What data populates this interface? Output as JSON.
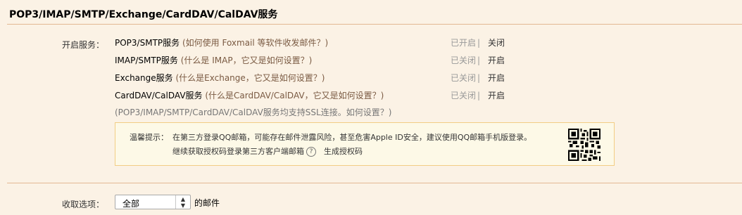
{
  "header": {
    "title": "POP3/IMAP/SMTP/Exchange/CardDAV/CalDAV服务"
  },
  "services_section": {
    "label": "开启服务：",
    "services": [
      {
        "name": "POP3/SMTP服务",
        "help": "(如何使用 Foxmail 等软件收发邮件？)",
        "status": "已开启",
        "action": "关闭"
      },
      {
        "name": "IMAP/SMTP服务",
        "help": "(什么是 IMAP，它又是如何设置？)",
        "status": "已关闭",
        "action": "开启"
      },
      {
        "name": "Exchange服务",
        "help": "(什么是Exchange，它又是如何设置？)",
        "status": "已关闭",
        "action": "开启"
      },
      {
        "name": "CardDAV/CalDAV服务",
        "help": "(什么是CardDAV/CalDAV，它又是如何设置？)",
        "status": "已关闭",
        "action": "开启"
      }
    ],
    "status_separator": "|",
    "ssl_note": {
      "prefix": "(POP3/IMAP/SMTP/CardDAV/CalDAV服务均支持SSL连接。",
      "link": "如何设置？",
      "suffix": ")"
    }
  },
  "tip": {
    "label": "温馨提示：",
    "line1": "在第三方登录QQ邮箱，可能存在邮件泄露风险，甚至危害Apple ID安全，建议使用QQ邮箱手机版登录。",
    "line2_prefix": "继续获取授权码登录第三方客户端邮箱",
    "help_icon_glyph": "?",
    "generate_link": "生成授权码",
    "qr_icon": "qr-code-icon"
  },
  "receive_options": {
    "label": "收取选项：",
    "selected": "全部",
    "suffix": "的邮件"
  },
  "colors": {
    "background": "#fbf2e5",
    "divider": "#e3b892",
    "tip_background": "#fdf9e7",
    "tip_border": "#f2cd84",
    "muted_text": "#999999"
  }
}
